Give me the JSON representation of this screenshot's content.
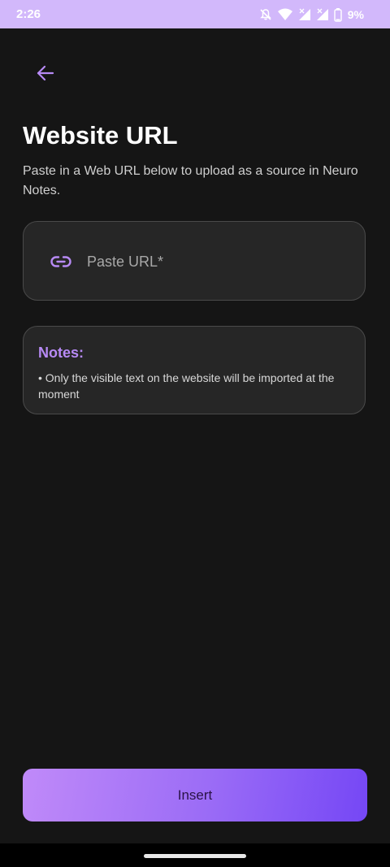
{
  "status_bar": {
    "time": "2:26",
    "battery": "9%",
    "icons": [
      "muted-bell-icon",
      "wifi-icon",
      "signal-icon",
      "signal-icon",
      "battery-icon"
    ]
  },
  "header": {
    "back_icon": "arrow-left-icon",
    "title": "Website URL",
    "subtitle": "Paste in a Web URL below to upload as a source in Neuro Notes."
  },
  "url_input": {
    "icon": "link-icon",
    "placeholder": "Paste URL*",
    "value": ""
  },
  "notes": {
    "title": "Notes:",
    "items": [
      "• Only the visible text on the website will be imported at the moment"
    ]
  },
  "actions": {
    "insert_label": "Insert"
  },
  "colors": {
    "accent": "#b78af5",
    "background": "#151515",
    "card": "#262626",
    "status_bar": "#d2b8fb",
    "button_gradient_start": "#c08af9",
    "button_gradient_end": "#7547f5"
  }
}
